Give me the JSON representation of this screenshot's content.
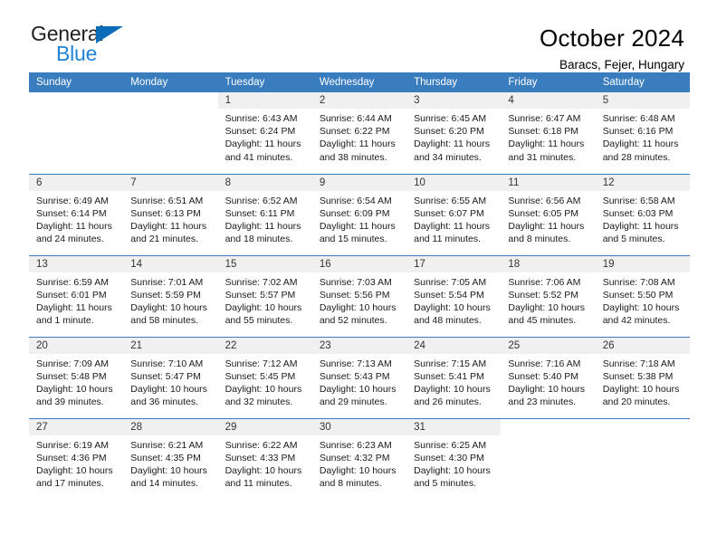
{
  "brand": {
    "name_top": "General",
    "name_bottom": "Blue",
    "accent_color": "#0b6cb7",
    "accent_color_light": "#2083d6"
  },
  "header": {
    "title": "October 2024",
    "subtitle": "Baracs, Fejer, Hungary",
    "header_bg": "#3a7dbe",
    "daynum_bg": "#f0f0f0"
  },
  "weekday_headers": [
    "Sunday",
    "Monday",
    "Tuesday",
    "Wednesday",
    "Thursday",
    "Friday",
    "Saturday"
  ],
  "weeks": [
    [
      {
        "day": "",
        "blank": true,
        "sunrise": "",
        "sunset": "",
        "daylight_1": "",
        "daylight_2": ""
      },
      {
        "day": "",
        "blank": true,
        "sunrise": "",
        "sunset": "",
        "daylight_1": "",
        "daylight_2": ""
      },
      {
        "day": "1",
        "sunrise": "Sunrise: 6:43 AM",
        "sunset": "Sunset: 6:24 PM",
        "daylight_1": "Daylight: 11 hours",
        "daylight_2": "and 41 minutes."
      },
      {
        "day": "2",
        "sunrise": "Sunrise: 6:44 AM",
        "sunset": "Sunset: 6:22 PM",
        "daylight_1": "Daylight: 11 hours",
        "daylight_2": "and 38 minutes."
      },
      {
        "day": "3",
        "sunrise": "Sunrise: 6:45 AM",
        "sunset": "Sunset: 6:20 PM",
        "daylight_1": "Daylight: 11 hours",
        "daylight_2": "and 34 minutes."
      },
      {
        "day": "4",
        "sunrise": "Sunrise: 6:47 AM",
        "sunset": "Sunset: 6:18 PM",
        "daylight_1": "Daylight: 11 hours",
        "daylight_2": "and 31 minutes."
      },
      {
        "day": "5",
        "sunrise": "Sunrise: 6:48 AM",
        "sunset": "Sunset: 6:16 PM",
        "daylight_1": "Daylight: 11 hours",
        "daylight_2": "and 28 minutes."
      }
    ],
    [
      {
        "day": "6",
        "sunrise": "Sunrise: 6:49 AM",
        "sunset": "Sunset: 6:14 PM",
        "daylight_1": "Daylight: 11 hours",
        "daylight_2": "and 24 minutes."
      },
      {
        "day": "7",
        "sunrise": "Sunrise: 6:51 AM",
        "sunset": "Sunset: 6:13 PM",
        "daylight_1": "Daylight: 11 hours",
        "daylight_2": "and 21 minutes."
      },
      {
        "day": "8",
        "sunrise": "Sunrise: 6:52 AM",
        "sunset": "Sunset: 6:11 PM",
        "daylight_1": "Daylight: 11 hours",
        "daylight_2": "and 18 minutes."
      },
      {
        "day": "9",
        "sunrise": "Sunrise: 6:54 AM",
        "sunset": "Sunset: 6:09 PM",
        "daylight_1": "Daylight: 11 hours",
        "daylight_2": "and 15 minutes."
      },
      {
        "day": "10",
        "sunrise": "Sunrise: 6:55 AM",
        "sunset": "Sunset: 6:07 PM",
        "daylight_1": "Daylight: 11 hours",
        "daylight_2": "and 11 minutes."
      },
      {
        "day": "11",
        "sunrise": "Sunrise: 6:56 AM",
        "sunset": "Sunset: 6:05 PM",
        "daylight_1": "Daylight: 11 hours",
        "daylight_2": "and 8 minutes."
      },
      {
        "day": "12",
        "sunrise": "Sunrise: 6:58 AM",
        "sunset": "Sunset: 6:03 PM",
        "daylight_1": "Daylight: 11 hours",
        "daylight_2": "and 5 minutes."
      }
    ],
    [
      {
        "day": "13",
        "sunrise": "Sunrise: 6:59 AM",
        "sunset": "Sunset: 6:01 PM",
        "daylight_1": "Daylight: 11 hours",
        "daylight_2": "and 1 minute."
      },
      {
        "day": "14",
        "sunrise": "Sunrise: 7:01 AM",
        "sunset": "Sunset: 5:59 PM",
        "daylight_1": "Daylight: 10 hours",
        "daylight_2": "and 58 minutes."
      },
      {
        "day": "15",
        "sunrise": "Sunrise: 7:02 AM",
        "sunset": "Sunset: 5:57 PM",
        "daylight_1": "Daylight: 10 hours",
        "daylight_2": "and 55 minutes."
      },
      {
        "day": "16",
        "sunrise": "Sunrise: 7:03 AM",
        "sunset": "Sunset: 5:56 PM",
        "daylight_1": "Daylight: 10 hours",
        "daylight_2": "and 52 minutes."
      },
      {
        "day": "17",
        "sunrise": "Sunrise: 7:05 AM",
        "sunset": "Sunset: 5:54 PM",
        "daylight_1": "Daylight: 10 hours",
        "daylight_2": "and 48 minutes."
      },
      {
        "day": "18",
        "sunrise": "Sunrise: 7:06 AM",
        "sunset": "Sunset: 5:52 PM",
        "daylight_1": "Daylight: 10 hours",
        "daylight_2": "and 45 minutes."
      },
      {
        "day": "19",
        "sunrise": "Sunrise: 7:08 AM",
        "sunset": "Sunset: 5:50 PM",
        "daylight_1": "Daylight: 10 hours",
        "daylight_2": "and 42 minutes."
      }
    ],
    [
      {
        "day": "20",
        "sunrise": "Sunrise: 7:09 AM",
        "sunset": "Sunset: 5:48 PM",
        "daylight_1": "Daylight: 10 hours",
        "daylight_2": "and 39 minutes."
      },
      {
        "day": "21",
        "sunrise": "Sunrise: 7:10 AM",
        "sunset": "Sunset: 5:47 PM",
        "daylight_1": "Daylight: 10 hours",
        "daylight_2": "and 36 minutes."
      },
      {
        "day": "22",
        "sunrise": "Sunrise: 7:12 AM",
        "sunset": "Sunset: 5:45 PM",
        "daylight_1": "Daylight: 10 hours",
        "daylight_2": "and 32 minutes."
      },
      {
        "day": "23",
        "sunrise": "Sunrise: 7:13 AM",
        "sunset": "Sunset: 5:43 PM",
        "daylight_1": "Daylight: 10 hours",
        "daylight_2": "and 29 minutes."
      },
      {
        "day": "24",
        "sunrise": "Sunrise: 7:15 AM",
        "sunset": "Sunset: 5:41 PM",
        "daylight_1": "Daylight: 10 hours",
        "daylight_2": "and 26 minutes."
      },
      {
        "day": "25",
        "sunrise": "Sunrise: 7:16 AM",
        "sunset": "Sunset: 5:40 PM",
        "daylight_1": "Daylight: 10 hours",
        "daylight_2": "and 23 minutes."
      },
      {
        "day": "26",
        "sunrise": "Sunrise: 7:18 AM",
        "sunset": "Sunset: 5:38 PM",
        "daylight_1": "Daylight: 10 hours",
        "daylight_2": "and 20 minutes."
      }
    ],
    [
      {
        "day": "27",
        "sunrise": "Sunrise: 6:19 AM",
        "sunset": "Sunset: 4:36 PM",
        "daylight_1": "Daylight: 10 hours",
        "daylight_2": "and 17 minutes."
      },
      {
        "day": "28",
        "sunrise": "Sunrise: 6:21 AM",
        "sunset": "Sunset: 4:35 PM",
        "daylight_1": "Daylight: 10 hours",
        "daylight_2": "and 14 minutes."
      },
      {
        "day": "29",
        "sunrise": "Sunrise: 6:22 AM",
        "sunset": "Sunset: 4:33 PM",
        "daylight_1": "Daylight: 10 hours",
        "daylight_2": "and 11 minutes."
      },
      {
        "day": "30",
        "sunrise": "Sunrise: 6:23 AM",
        "sunset": "Sunset: 4:32 PM",
        "daylight_1": "Daylight: 10 hours",
        "daylight_2": "and 8 minutes."
      },
      {
        "day": "31",
        "sunrise": "Sunrise: 6:25 AM",
        "sunset": "Sunset: 4:30 PM",
        "daylight_1": "Daylight: 10 hours",
        "daylight_2": "and 5 minutes."
      },
      {
        "day": "",
        "blank": true,
        "sunrise": "",
        "sunset": "",
        "daylight_1": "",
        "daylight_2": ""
      },
      {
        "day": "",
        "blank": true,
        "sunrise": "",
        "sunset": "",
        "daylight_1": "",
        "daylight_2": ""
      }
    ]
  ]
}
